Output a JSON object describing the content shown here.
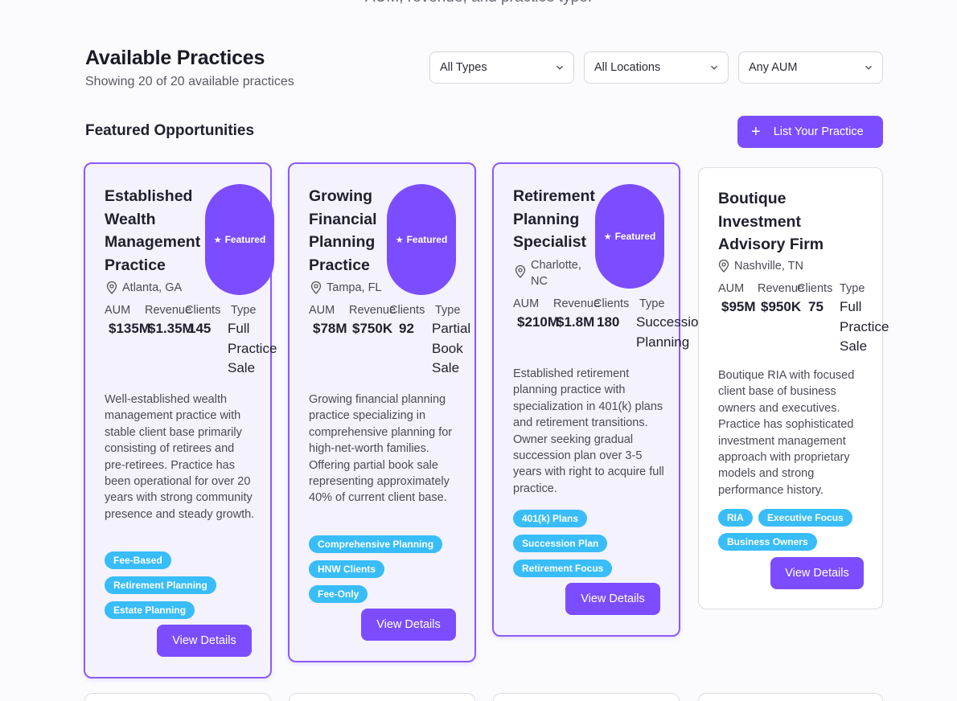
{
  "header": {
    "top_subtitle": "AUM, revenue, and practice type.",
    "title": "Available Practices",
    "subtitle": "Showing 20 of 20 available practices"
  },
  "filters": {
    "type": "All Types",
    "location": "All Locations",
    "aum": "Any AUM"
  },
  "featured": {
    "section_title": "Featured Opportunities",
    "list_button": "List Your Practice"
  },
  "labels": {
    "aum": "AUM",
    "revenue": "Revenue",
    "clients": "Clients",
    "type": "Type",
    "featured_badge": "Featured",
    "view_details": "View Details"
  },
  "cards": [
    {
      "title": "Established Wealth Management Practice",
      "location": "Atlanta, GA",
      "aum": "$135M",
      "revenue": "$1.35M",
      "clients": "145",
      "type": "Full Practice Sale",
      "description": "Well-established wealth management practice with stable client base primarily consisting of retirees and pre-retirees. Practice has been operational for over 20 years with strong community presence and steady growth.",
      "tags": [
        "Fee-Based",
        "Retirement Planning",
        "Estate Planning"
      ],
      "featured": true
    },
    {
      "title": "Growing Financial Planning Practice",
      "location": "Tampa, FL",
      "aum": "$78M",
      "revenue": "$750K",
      "clients": "92",
      "type": "Partial Book Sale",
      "description": "Growing financial planning practice specializing in comprehensive planning for high-net-worth families. Offering partial book sale representing approximately 40% of current client base.",
      "tags": [
        "Comprehensive Planning",
        "HNW Clients",
        "Fee-Only"
      ],
      "featured": true
    },
    {
      "title": "Retirement Planning Specialist",
      "location": "Charlotte, NC",
      "aum": "$210M",
      "revenue": "$1.8M",
      "clients": "180",
      "type": "Succession Planning",
      "description": "Established retirement planning practice with specialization in 401(k) plans and retirement transitions. Owner seeking gradual succession plan over 3-5 years with right to acquire full practice.",
      "tags": [
        "401(k) Plans",
        "Succession Plan",
        "Retirement Focus"
      ],
      "featured": true
    },
    {
      "title": "Boutique Investment Advisory Firm",
      "location": "Nashville, TN",
      "aum": "$95M",
      "revenue": "$950K",
      "clients": "75",
      "type": "Full Practice Sale",
      "description": "Boutique RIA with focused client base of business owners and executives. Practice has sophisticated investment management approach with proprietary models and strong performance history.",
      "tags": [
        "RIA",
        "Executive Focus",
        "Business Owners"
      ],
      "featured": false
    }
  ],
  "colors": {
    "accent": "#7c4dff",
    "tag": "#38bdf8",
    "featured_bg": "#f4f2fd",
    "featured_border": "#8b5cf6"
  }
}
